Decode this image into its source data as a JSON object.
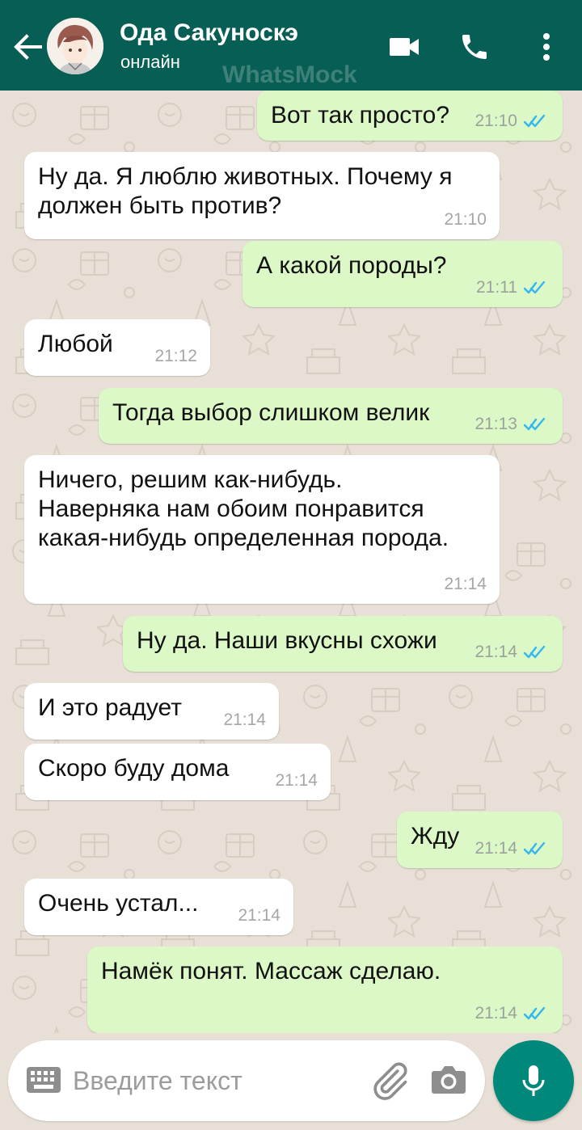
{
  "header": {
    "contact_name": "Ода Сакуноскэ",
    "status": "онлайн",
    "watermark": "WhatsMock",
    "icons": [
      "back-arrow-icon",
      "avatar",
      "video-call-icon",
      "phone-icon",
      "more-vert-icon"
    ],
    "bar_color": "#075e54"
  },
  "messages": [
    {
      "dir": "out",
      "lines": [
        "Вот так просто?"
      ],
      "time": "21:10",
      "read": true
    },
    {
      "dir": "in",
      "lines": [
        "Ну да. Я люблю животных. Почему я",
        "должен быть против?"
      ],
      "time": "21:10"
    },
    {
      "dir": "out",
      "lines": [
        "А какой породы?"
      ],
      "time": "21:11",
      "read": true
    },
    {
      "dir": "in",
      "lines": [
        "Любой"
      ],
      "time": "21:12"
    },
    {
      "dir": "out",
      "lines": [
        "Тогда выбор слишком велик"
      ],
      "time": "21:13",
      "read": true
    },
    {
      "dir": "in",
      "lines": [
        "Ничего, решим как-нибудь.",
        "Наверняка нам обоим понравится",
        "какая-нибудь определенная порода."
      ],
      "time": "21:14"
    },
    {
      "dir": "out",
      "lines": [
        "Ну да. Наши вкусны схожи"
      ],
      "time": "21:14",
      "read": true
    },
    {
      "dir": "in",
      "lines": [
        "И это радует"
      ],
      "time": "21:14"
    },
    {
      "dir": "in",
      "lines": [
        "Скоро буду дома"
      ],
      "time": "21:14"
    },
    {
      "dir": "out",
      "lines": [
        "Жду"
      ],
      "time": "21:14",
      "read": true
    },
    {
      "dir": "in",
      "lines": [
        "Очень устал..."
      ],
      "time": "21:14"
    },
    {
      "dir": "out",
      "lines": [
        "Намёк понят. Массаж сделаю."
      ],
      "time": "21:14",
      "read": true
    }
  ],
  "input": {
    "placeholder": "Введите текст",
    "icons": [
      "keyboard-icon",
      "attach-clip-icon",
      "camera-icon",
      "mic-icon"
    ]
  },
  "colors": {
    "outgoing_bubble": "#dcf8c6",
    "incoming_bubble": "#ffffff",
    "read_ticks": "#34b7f1",
    "wallpaper": "#e8e0d6",
    "mic_button": "#00897b"
  }
}
